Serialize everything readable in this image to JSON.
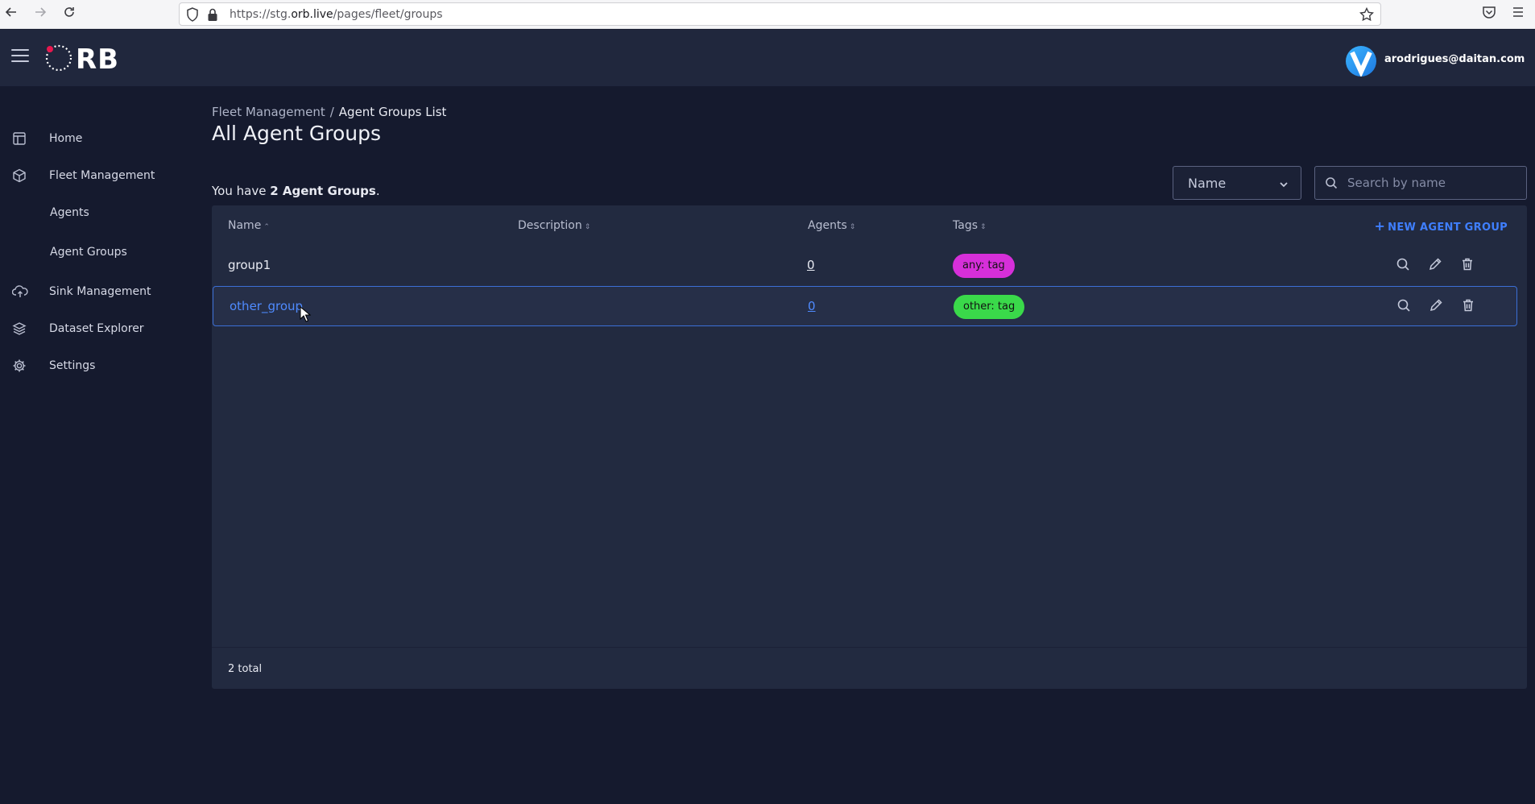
{
  "browser": {
    "url_prefix": "https://stg.",
    "url_domain": "orb.live",
    "url_path": "/pages/fleet/groups"
  },
  "header": {
    "logo_text": "RB",
    "user_email": "arodrigues@daitan.com"
  },
  "sidebar": {
    "items": [
      {
        "label": "Home",
        "icon": "layout-icon"
      },
      {
        "label": "Fleet Management",
        "icon": "cube-icon"
      },
      {
        "label": "Agents",
        "icon": ""
      },
      {
        "label": "Agent Groups",
        "icon": ""
      },
      {
        "label": "Sink Management",
        "icon": "cloud-upload-icon"
      },
      {
        "label": "Dataset Explorer",
        "icon": "layers-icon"
      },
      {
        "label": "Settings",
        "icon": "gear-icon"
      }
    ]
  },
  "breadcrumb": {
    "parent": "Fleet Management",
    "separator": "/",
    "current": "Agent Groups List"
  },
  "page": {
    "title": "All Agent Groups",
    "count_prefix": "You have ",
    "count_bold": "2 Agent Groups",
    "count_suffix": "."
  },
  "filter": {
    "selected": "Name",
    "search_placeholder": "Search by name"
  },
  "table": {
    "columns": [
      {
        "label": "Name",
        "sort": "⌃"
      },
      {
        "label": "Description",
        "sort": "⇕"
      },
      {
        "label": "Agents",
        "sort": "⇕"
      },
      {
        "label": "Tags",
        "sort": "⇕"
      }
    ],
    "new_button": "NEW AGENT GROUP",
    "rows": [
      {
        "name": "group1",
        "agents": "0",
        "tag": "any: tag",
        "tag_color": "#d62fd9"
      },
      {
        "name": "other_group",
        "agents": "0",
        "tag": "other: tag",
        "tag_color": "#3ad94a"
      }
    ],
    "footer": "2 total"
  },
  "colors": {
    "accent": "#3f7fff",
    "background": "#151a2e",
    "card": "#222a40"
  }
}
